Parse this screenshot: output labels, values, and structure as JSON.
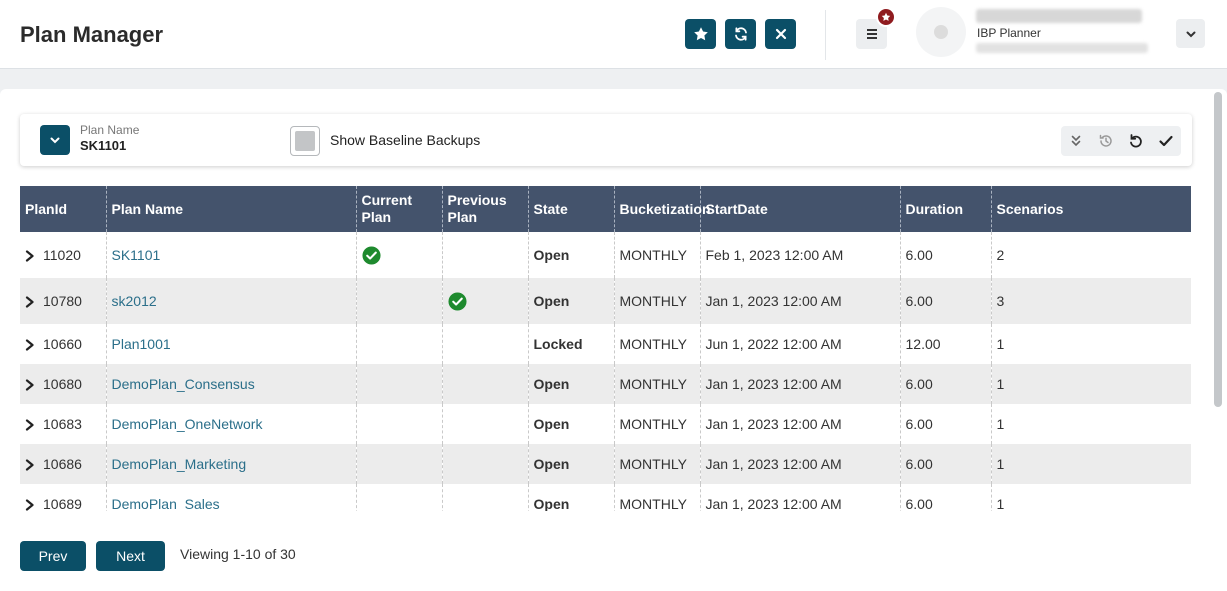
{
  "header": {
    "title": "Plan Manager",
    "buttons": [
      {
        "name": "favorite",
        "icon": "star-icon"
      },
      {
        "name": "refresh",
        "icon": "refresh-icon"
      },
      {
        "name": "close",
        "icon": "close-icon"
      }
    ],
    "user": {
      "role": "IBP Planner"
    }
  },
  "filter": {
    "plan_name_label": "Plan Name",
    "plan_name_value": "SK1101",
    "show_baseline_label": "Show Baseline Backups",
    "show_baseline_checked": false
  },
  "table": {
    "columns": [
      "PlanId",
      "Plan Name",
      "Current Plan",
      "Previous Plan",
      "State",
      "Bucketization",
      "StartDate",
      "Duration",
      "Scenarios"
    ],
    "rows": [
      {
        "plan_id": "11020",
        "plan_name": "SK1101",
        "current": true,
        "previous": false,
        "state": "Open",
        "bucketization": "MONTHLY",
        "start_date": "Feb 1, 2023 12:00 AM",
        "duration": "6.00",
        "scenarios": "2"
      },
      {
        "plan_id": "10780",
        "plan_name": "sk2012",
        "current": false,
        "previous": true,
        "state": "Open",
        "bucketization": "MONTHLY",
        "start_date": "Jan 1, 2023 12:00 AM",
        "duration": "6.00",
        "scenarios": "3"
      },
      {
        "plan_id": "10660",
        "plan_name": "Plan1001",
        "current": false,
        "previous": false,
        "state": "Locked",
        "bucketization": "MONTHLY",
        "start_date": "Jun 1, 2022 12:00 AM",
        "duration": "12.00",
        "scenarios": "1"
      },
      {
        "plan_id": "10680",
        "plan_name": "DemoPlan_Consensus",
        "current": false,
        "previous": false,
        "state": "Open",
        "bucketization": "MONTHLY",
        "start_date": "Jan 1, 2023 12:00 AM",
        "duration": "6.00",
        "scenarios": "1"
      },
      {
        "plan_id": "10683",
        "plan_name": "DemoPlan_OneNetwork",
        "current": false,
        "previous": false,
        "state": "Open",
        "bucketization": "MONTHLY",
        "start_date": "Jan 1, 2023 12:00 AM",
        "duration": "6.00",
        "scenarios": "1"
      },
      {
        "plan_id": "10686",
        "plan_name": "DemoPlan_Marketing",
        "current": false,
        "previous": false,
        "state": "Open",
        "bucketization": "MONTHLY",
        "start_date": "Jan 1, 2023 12:00 AM",
        "duration": "6.00",
        "scenarios": "1"
      },
      {
        "plan_id": "10689",
        "plan_name": "DemoPlan_Sales",
        "current": false,
        "previous": false,
        "state": "Open",
        "bucketization": "MONTHLY",
        "start_date": "Jan 1, 2023 12:00 AM",
        "duration": "6.00",
        "scenarios": "1"
      }
    ]
  },
  "pager": {
    "prev_label": "Prev",
    "next_label": "Next",
    "viewing_text": "Viewing 1-10 of 30"
  },
  "colors": {
    "primary": "#0b4f67",
    "table_header": "#44536c",
    "link": "#2b6f8a",
    "check_green": "#1e8a2e",
    "badge": "#8f1b1f"
  }
}
